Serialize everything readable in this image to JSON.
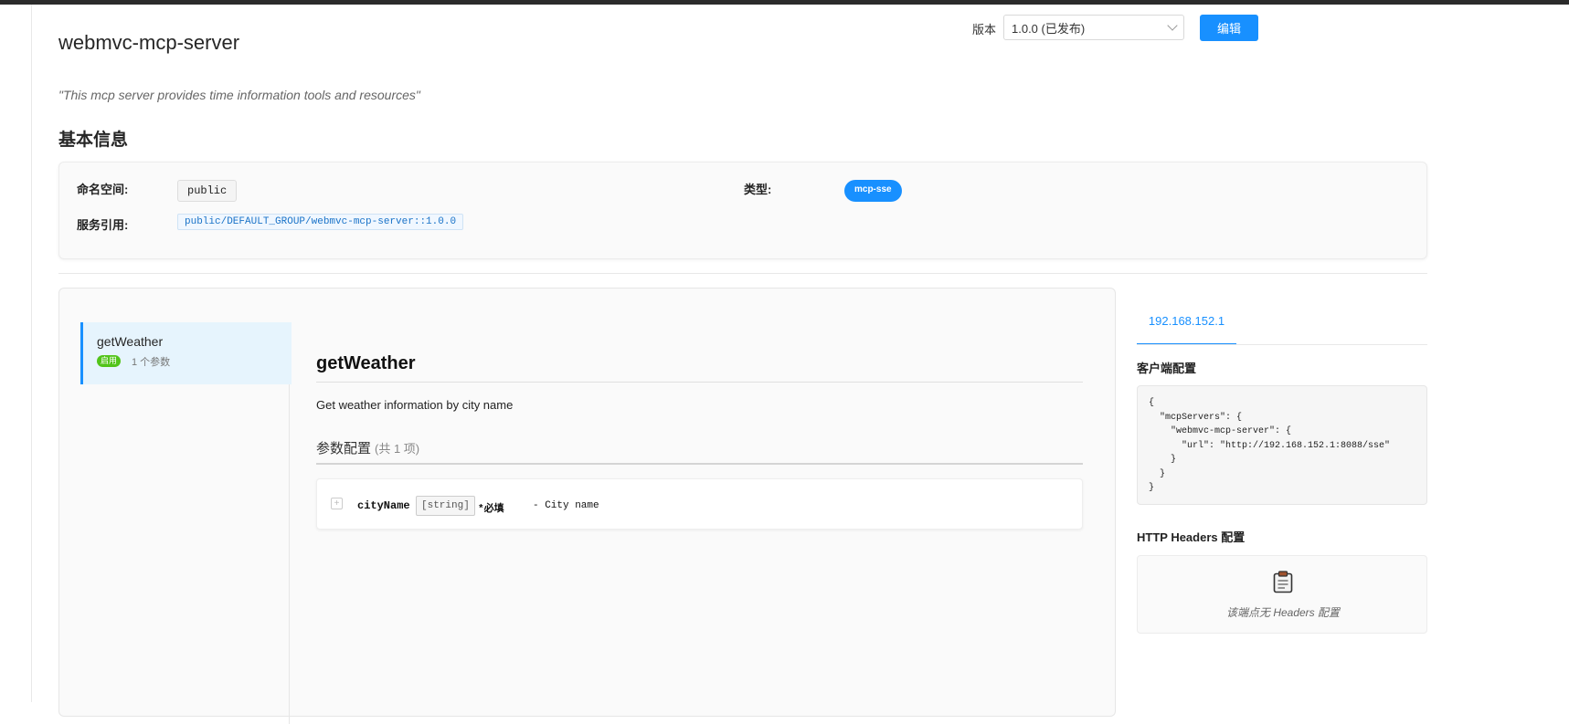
{
  "header": {
    "title": "webmvc-mcp-server",
    "version_label": "版本",
    "version_selected": "1.0.0 (已发布)",
    "edit_button": "编辑"
  },
  "description": "\"This mcp server provides time information tools and resources\"",
  "basic_info": {
    "section_title": "基本信息",
    "namespace_label": "命名空间:",
    "namespace_value": "public",
    "type_label": "类型:",
    "type_value": "mcp-sse",
    "service_ref_label": "服务引用:",
    "service_ref_value": "public/DEFAULT_GROUP/webmvc-mcp-server::1.0.0"
  },
  "tools": {
    "list": [
      {
        "name": "getWeather",
        "status": "启用",
        "params_count": "1 个参数"
      }
    ],
    "detail": {
      "name": "getWeather",
      "description": "Get weather information by city name",
      "params_title": "参数配置",
      "params_count": "(共 1 项)",
      "params": [
        {
          "name": "cityName",
          "type": "[string]",
          "required": "*必填",
          "desc": "- City name"
        }
      ]
    }
  },
  "endpoint": {
    "tab": "192.168.152.1",
    "client_config_title": "客户端配置",
    "client_config_code": "{\n  \"mcpServers\": {\n    \"webmvc-mcp-server\": {\n      \"url\": \"http://192.168.152.1:8088/sse\"\n    }\n  }\n}",
    "headers_title": "HTTP Headers 配置",
    "headers_empty": "该端点无 Headers 配置"
  },
  "colors": {
    "accent": "#1890ff",
    "enabled_badge": "#52c41a",
    "topbar": "#2b2b2b"
  }
}
